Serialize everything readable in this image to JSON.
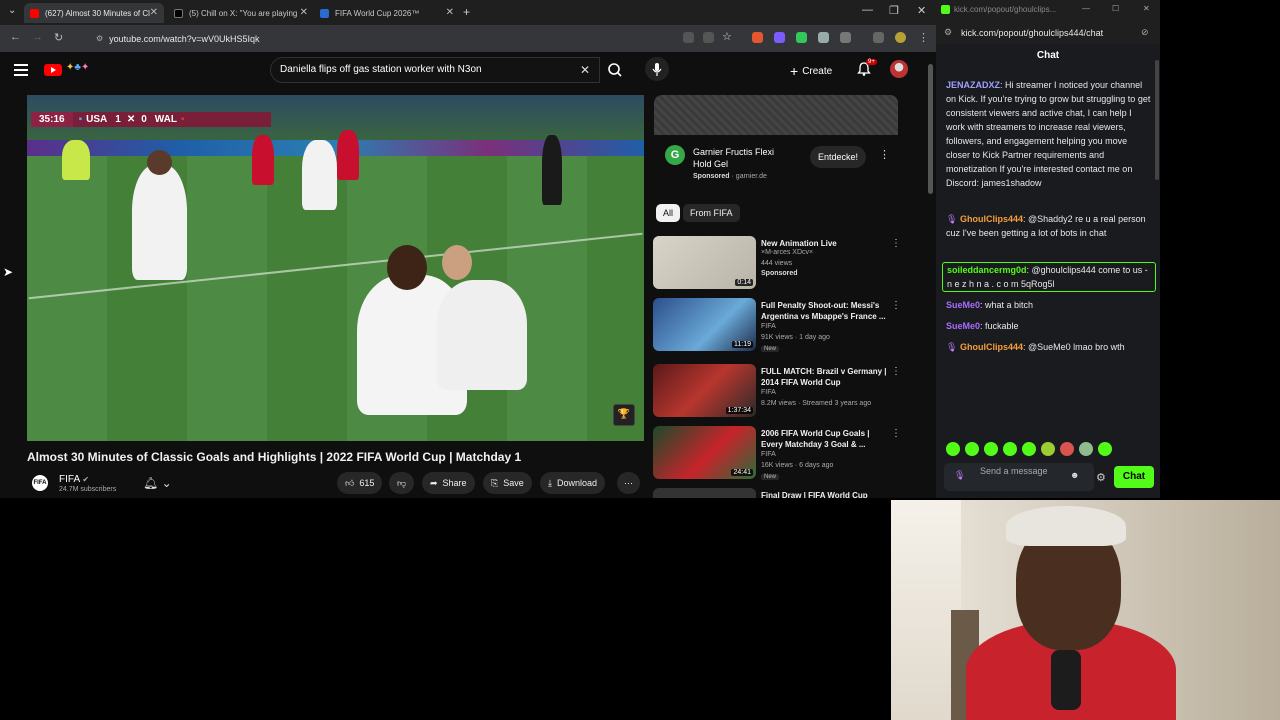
{
  "browser": {
    "tabs": [
      {
        "label": "(627) Almost 30 Minutes of Cl",
        "active": true
      },
      {
        "label": "(5) Chill on X: \"You are playing",
        "active": false
      },
      {
        "label": "FIFA World Cup 2026™",
        "active": false
      }
    ],
    "new_tab": "+",
    "url": "youtube.com/watch?v=wV0UkHS5Iqk"
  },
  "youtube": {
    "search_query": "Daniella flips off gas station worker with N3on",
    "create_label": "Create",
    "notif_count": "9+",
    "scorebug": {
      "clock": "35:16",
      "home": "USA",
      "home_score": "1",
      "away_score": "0",
      "away": "WAL"
    },
    "video_title": "Almost 30 Minutes of Classic Goals and Highlights | 2022 FIFA World Cup | Matchday 1",
    "channel": {
      "name": "FIFA",
      "subscribers": "24.7M subscribers",
      "avatar_text": "FIFA"
    },
    "actions": {
      "likes": "615",
      "share": "Share",
      "save": "Save",
      "download": "Download"
    },
    "ad": {
      "title": "Garnier Fructis Flexi Hold Gel",
      "sponsored": "Sponsored",
      "domain": "garnier.de",
      "cta": "Entdecke!"
    },
    "chips": [
      "All",
      "From FIFA"
    ],
    "recommendations": [
      {
        "title": "New Animation Live",
        "channel": "×M-arces XDcv×",
        "meta": "444 views",
        "badge": "Sponsored",
        "duration": "0:14"
      },
      {
        "title": "Full Penalty Shoot-out: Messi's Argentina vs Mbappe's France ...",
        "channel": "FIFA",
        "meta": "91K views · 1 day ago",
        "badge": "New",
        "duration": "11:19"
      },
      {
        "title": "FULL MATCH: Brazil v Germany | 2014 FIFA World Cup",
        "channel": "FIFA",
        "meta": "8.2M views · Streamed 3 years ago",
        "badge": "",
        "duration": "1:37:34"
      },
      {
        "title": "2006 FIFA World Cup Goals | Every Matchday 3 Goal & ...",
        "channel": "FIFA",
        "meta": "16K views · 6 days ago",
        "badge": "New",
        "duration": "24:41"
      },
      {
        "title": "Final Draw | FIFA World Cup",
        "channel": "",
        "meta": "",
        "badge": "",
        "duration": ""
      }
    ]
  },
  "kick": {
    "window_title": "kick.com/popout/ghoulclips...",
    "url": "kick.com/popout/ghoulclips444/chat",
    "header": "Chat",
    "messages": [
      {
        "user": "JENAZADXZ",
        "text": ": Hi streamer I noticed your channel on Kick. If you're trying to grow but struggling to get consistent viewers and active chat, I can help I work with streamers to increase real viewers, followers, and engagement helping you move closer to Kick Partner requirements and monetization If you're interested contact me on Discord: james1shadow",
        "color": "#a0a0ff"
      },
      {
        "user": "GhoulClips444",
        "text": ": @Shaddy2 re u a real person cuz I've been getting a lot of bots in chat",
        "color": "#f59e3b"
      },
      {
        "user": "soileddancermg0d",
        "text": ": @ghoulclips444 come to us - n e z h n a . c o m 5qRog5l",
        "color": "#53fc18"
      },
      {
        "user": "SueMe0",
        "text": ": what a bitch",
        "color": "#a86cff"
      },
      {
        "user": "SueMe0",
        "text": ": fuckable",
        "color": "#a86cff"
      },
      {
        "user": "GhoulClips444",
        "text": ": @SueMe0 lmao bro wth",
        "color": "#f59e3b"
      }
    ],
    "input_placeholder": "Send a message",
    "send_label": "Chat"
  }
}
